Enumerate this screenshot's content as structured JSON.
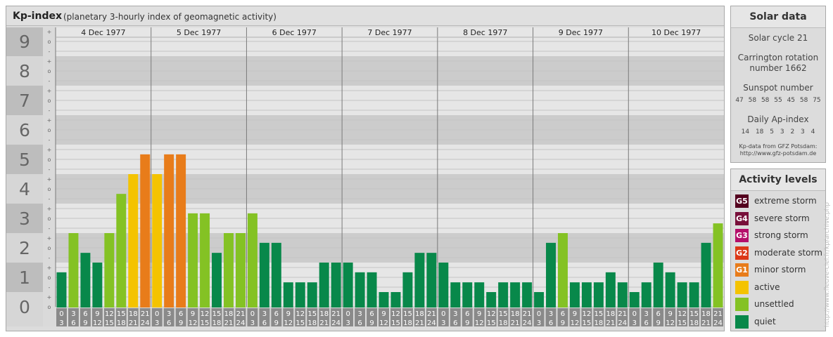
{
  "header": {
    "title": "Kp-index",
    "subtitle": "(planetary 3-hourly index of geomagnetic activity)"
  },
  "chart_data": {
    "type": "bar",
    "title": "Kp-index",
    "y_axis_labels": [
      "0",
      "1",
      "2",
      "3",
      "4",
      "5",
      "6",
      "7",
      "8",
      "9"
    ],
    "minor_tick_labels": [
      "o",
      "+",
      "-"
    ],
    "ylim": [
      0,
      9
    ],
    "days": [
      "4 Dec 1977",
      "5 Dec 1977",
      "6 Dec 1977",
      "7 Dec 1977",
      "8 Dec 1977",
      "9 Dec 1977",
      "10 Dec 1977"
    ],
    "x_tick_labels": [
      [
        "0",
        "3"
      ],
      [
        "3",
        "6"
      ],
      [
        "6",
        "9"
      ],
      [
        "9",
        "12"
      ],
      [
        "12",
        "15"
      ],
      [
        "15",
        "18"
      ],
      [
        "18",
        "21"
      ],
      [
        "21",
        "24"
      ]
    ],
    "values": [
      [
        0.67,
        2.0,
        1.33,
        1.0,
        2.0,
        3.33,
        4.0,
        4.67
      ],
      [
        4.0,
        4.67,
        4.67,
        2.67,
        2.67,
        1.33,
        2.0,
        2.0
      ],
      [
        2.67,
        1.67,
        1.67,
        0.33,
        0.33,
        0.33,
        1.0,
        1.0
      ],
      [
        1.0,
        0.67,
        0.67,
        0.0,
        0.0,
        0.67,
        1.33,
        1.33
      ],
      [
        1.0,
        0.33,
        0.33,
        0.33,
        0.0,
        0.33,
        0.33,
        0.33
      ],
      [
        0.0,
        1.67,
        2.0,
        0.33,
        0.33,
        0.33,
        0.67,
        0.33
      ],
      [
        0.0,
        0.33,
        1.0,
        0.67,
        0.33,
        0.33,
        1.67,
        2.33
      ]
    ],
    "color_rule": {
      "quiet_below": 2,
      "unsettled_below": 4,
      "active_below": 4.5,
      "minor_storm_below": 5.5
    },
    "grid": true
  },
  "solar": {
    "title": "Solar data",
    "cycle": "Solar cycle 21",
    "carrington_line1": "Carrington rotation",
    "carrington_line2": "number 1662",
    "sunspot_title": "Sunspot number",
    "sunspot_values": "47 58 58 55 45 58 75",
    "ap_title": "Daily Ap-index",
    "ap_values": "14 18 5 3 2 3 4",
    "source_line1": "Kp-data from GFZ Potsdam:",
    "source_line2": "http://www.gfz-potsdam.de"
  },
  "levels": {
    "title": "Activity levels",
    "items": [
      {
        "code": "G5",
        "label": "extreme storm",
        "color": "#54001e"
      },
      {
        "code": "G4",
        "label": "severe storm",
        "color": "#78103a"
      },
      {
        "code": "G3",
        "label": "strong storm",
        "color": "#b40e6a"
      },
      {
        "code": "G2",
        "label": "moderate storm",
        "color": "#dc3816"
      },
      {
        "code": "G1",
        "label": "minor storm",
        "color": "#e87c1a"
      },
      {
        "code": "",
        "label": "active",
        "color": "#f4c300"
      },
      {
        "code": "",
        "label": "unsettled",
        "color": "#84c224"
      },
      {
        "code": "",
        "label": "quiet",
        "color": "#08884a"
      }
    ]
  },
  "credit": "http://www.fleuve-ciel.fr/kp/archive.php"
}
